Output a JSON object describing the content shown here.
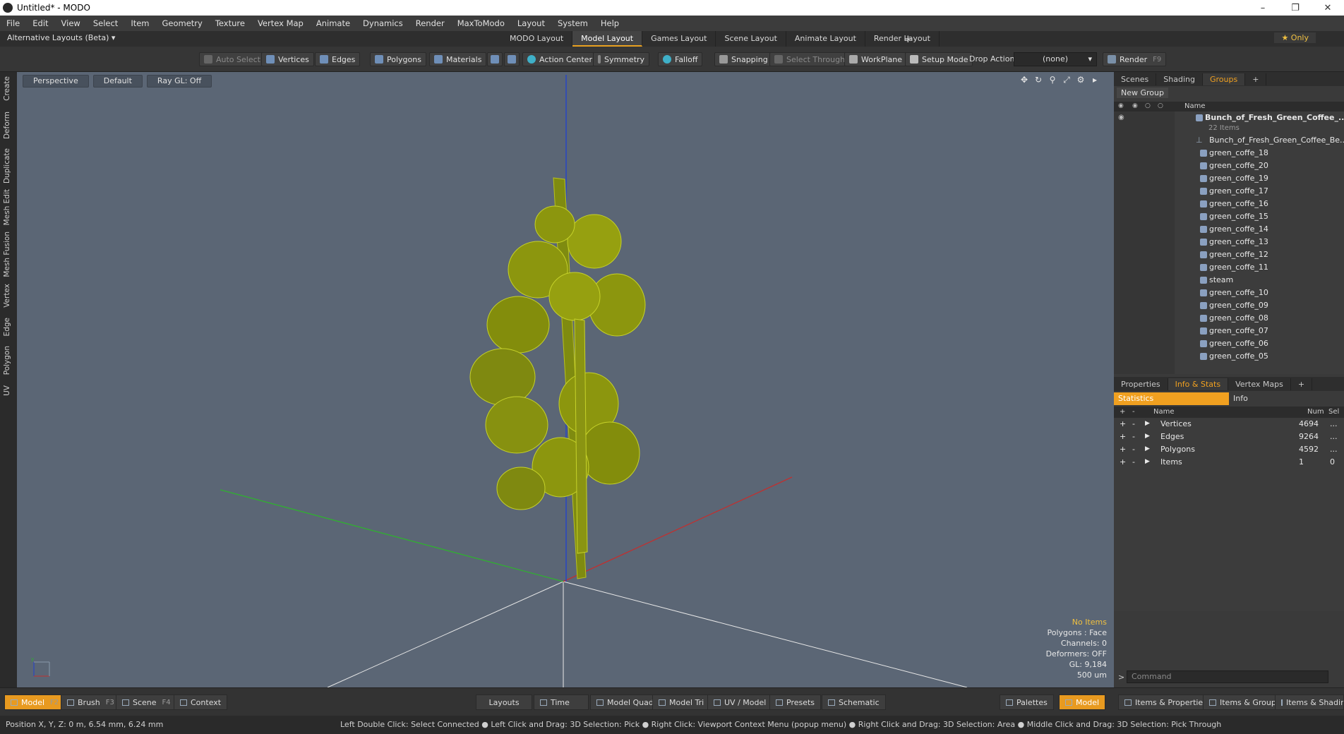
{
  "window": {
    "title": "Untitled* - MODO"
  },
  "menu": [
    "File",
    "Edit",
    "View",
    "Select",
    "Item",
    "Geometry",
    "Texture",
    "Vertex Map",
    "Animate",
    "Dynamics",
    "Render",
    "MaxToModo",
    "Layout",
    "System",
    "Help"
  ],
  "layout_bar": {
    "alt_layouts": "Alternative Layouts (Beta) ▾",
    "tabs": [
      "MODO Layout",
      "Model Layout",
      "Games Layout",
      "Scene Layout",
      "Animate Layout",
      "Render Layout"
    ],
    "active_tab": "Model Layout",
    "only_label": "★  Only"
  },
  "toolbar": {
    "auto_select": "Auto Select",
    "vertices": "Vertices",
    "edges": "Edges",
    "polygons": "Polygons",
    "materials": "Materials",
    "action_center": "Action Center",
    "symmetry": "Symmetry",
    "falloff": "Falloff",
    "snapping": "Snapping",
    "select_through": "Select Through",
    "workplane": "WorkPlane",
    "setup_mode": "Setup Mode",
    "drop_action_label": "Drop Action",
    "drop_action_value": "(none)",
    "render": "Render",
    "render_key": "F9"
  },
  "left_tabs": [
    "Create",
    "Deform",
    "Duplicate",
    "Mesh Edit",
    "Mesh Fusion",
    "Vertex",
    "Edge",
    "Polygon",
    "UV"
  ],
  "viewport": {
    "view": "Perspective",
    "shading": "Default",
    "raygl": "Ray GL: Off",
    "info": {
      "items": "No Items",
      "polygons": "Polygons : Face",
      "channels": "Channels: 0",
      "deformers": "Deformers: OFF",
      "gl": "GL: 9,184",
      "scale": "500 um"
    },
    "colors": {
      "background": "#5b6675",
      "mesh": "#9a9a10",
      "x_axis": "#c03030",
      "y_axis": "#2040d0",
      "z_axis": "#30b030"
    }
  },
  "groups_panel": {
    "tabs": [
      "Scenes",
      "Shading",
      "Groups"
    ],
    "active_tab": "Groups",
    "new_group": "New Group",
    "name_header": "Name",
    "root": "Bunch_of_Fresh_Green_Coffee_...",
    "root_count": "22 Items",
    "items": [
      "Bunch_of_Fresh_Green_Coffee_Be...",
      "green_coffe_18",
      "green_coffe_20",
      "green_coffe_19",
      "green_coffe_17",
      "green_coffe_16",
      "green_coffe_15",
      "green_coffe_14",
      "green_coffe_13",
      "green_coffe_12",
      "green_coffe_11",
      "steam",
      "green_coffe_10",
      "green_coffe_09",
      "green_coffe_08",
      "green_coffe_07",
      "green_coffe_06",
      "green_coffe_05"
    ]
  },
  "stats_panel": {
    "tabs": [
      "Properties",
      "Info & Stats",
      "Vertex Maps"
    ],
    "active_tab": "Info & Stats",
    "subtabs": [
      "Statistics",
      "Info"
    ],
    "headers": {
      "name": "Name",
      "num": "Num",
      "sel": "Sel"
    },
    "rows": [
      {
        "name": "Vertices",
        "num": "4694",
        "sel": "..."
      },
      {
        "name": "Edges",
        "num": "9264",
        "sel": "..."
      },
      {
        "name": "Polygons",
        "num": "4592",
        "sel": "..."
      },
      {
        "name": "Items",
        "num": "1",
        "sel": "0"
      }
    ],
    "command_placeholder": "Command"
  },
  "bottom_bar": {
    "model": "Model",
    "model_key": "F2",
    "brush": "Brush",
    "brush_key": "F3",
    "scene": "Scene",
    "scene_key": "F4",
    "context": "Context",
    "layouts": "Layouts",
    "time": "Time",
    "model_quad": "Model Quad",
    "model_tri": "Model Tri",
    "uv_model": "UV / Model",
    "presets": "Presets",
    "schematic": "Schematic",
    "palettes": "Palettes",
    "model_right": "Model",
    "items_properties": "Items & Properties",
    "items_groups": "Items & Groups",
    "items_shading": "Items & Shading"
  },
  "status": {
    "position": "Position X, Y, Z:   0 m, 6.54 mm, 6.24 mm",
    "hints": "Left Double Click: Select Connected ● Left Click and Drag: 3D Selection: Pick ● Right Click: Viewport Context Menu (popup menu) ● Right Click and Drag: 3D Selection: Area ● Middle Click and Drag: 3D Selection: Pick Through"
  }
}
